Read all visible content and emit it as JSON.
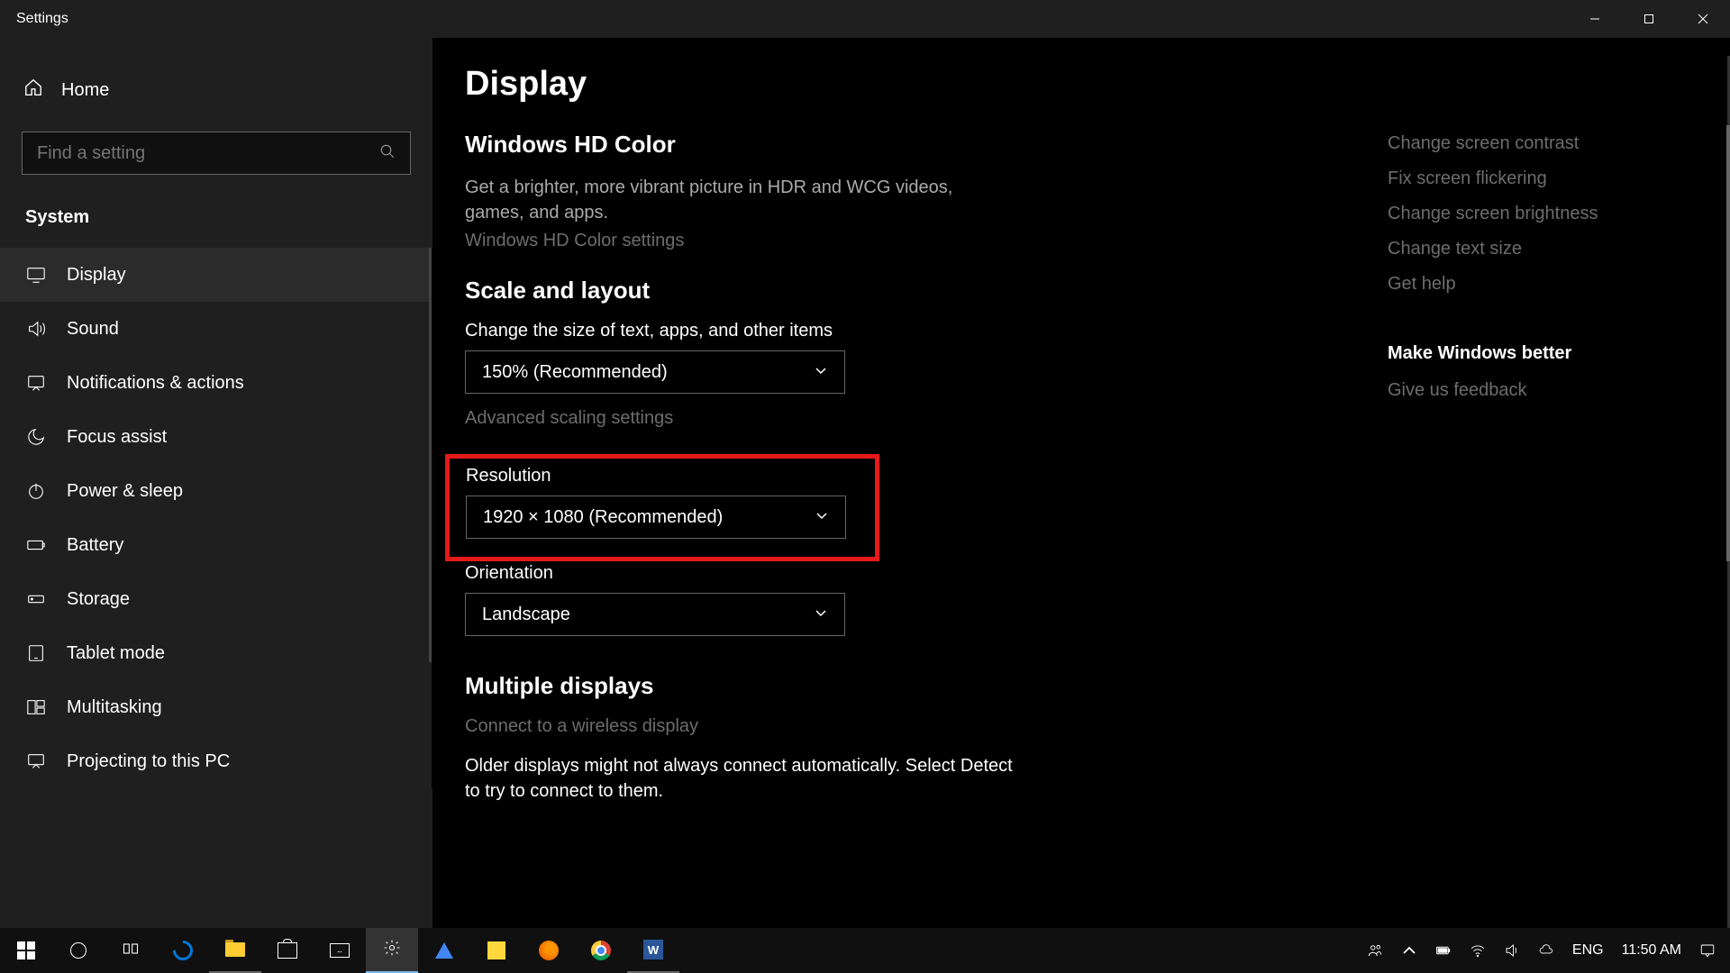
{
  "window": {
    "title": "Settings"
  },
  "sidebar": {
    "home": "Home",
    "search_placeholder": "Find a setting",
    "heading": "System",
    "items": [
      {
        "label": "Display",
        "active": true
      },
      {
        "label": "Sound"
      },
      {
        "label": "Notifications & actions"
      },
      {
        "label": "Focus assist"
      },
      {
        "label": "Power & sleep"
      },
      {
        "label": "Battery"
      },
      {
        "label": "Storage"
      },
      {
        "label": "Tablet mode"
      },
      {
        "label": "Multitasking"
      },
      {
        "label": "Projecting to this PC"
      }
    ]
  },
  "main": {
    "title": "Display",
    "hd": {
      "heading": "Windows HD Color",
      "desc": "Get a brighter, more vibrant picture in HDR and WCG videos, games, and apps.",
      "link": "Windows HD Color settings"
    },
    "scale": {
      "heading": "Scale and layout",
      "change_label": "Change the size of text, apps, and other items",
      "scale_value": "150% (Recommended)",
      "adv_link": "Advanced scaling settings",
      "res_label": "Resolution",
      "res_value": "1920 × 1080 (Recommended)",
      "orient_label": "Orientation",
      "orient_value": "Landscape"
    },
    "multi": {
      "heading": "Multiple displays",
      "link": "Connect to a wireless display",
      "desc": "Older displays might not always connect automatically. Select Detect to try to connect to them."
    }
  },
  "rail": {
    "links": [
      "Change screen contrast",
      "Fix screen flickering",
      "Change screen brightness",
      "Change text size",
      "Get help"
    ],
    "feedback_heading": "Make Windows better",
    "feedback_link": "Give us feedback"
  },
  "taskbar": {
    "lang": "ENG",
    "time": "11:50 AM"
  }
}
